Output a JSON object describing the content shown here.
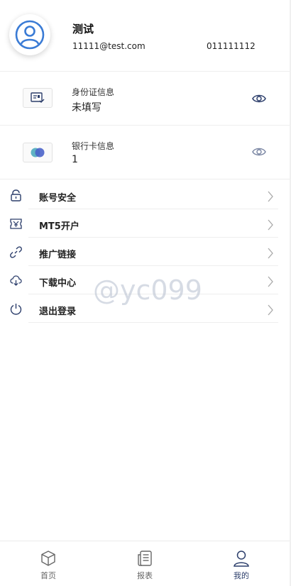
{
  "profile": {
    "username": "测试",
    "email": "11111@test.com",
    "phone": "011111112",
    "avatar_icon": "user-avatar-icon"
  },
  "id_info": {
    "title": "身份证信息",
    "value": "未填写",
    "icon": "id-card-icon"
  },
  "bank_info": {
    "title": "银行卡信息",
    "value": "1",
    "icon": "bank-card-icon"
  },
  "menu": {
    "items": [
      {
        "label": "账号安全",
        "icon": "lock-icon"
      },
      {
        "label": "MT5开户",
        "icon": "ticket-icon"
      },
      {
        "label": "推广链接",
        "icon": "link-icon"
      },
      {
        "label": "下载中心",
        "icon": "cloud-download-icon"
      },
      {
        "label": "退出登录",
        "icon": "power-icon"
      }
    ]
  },
  "watermark": "@yc099",
  "tabbar": {
    "tabs": [
      {
        "label": "首页",
        "icon": "cube-icon"
      },
      {
        "label": "报表",
        "icon": "report-icon"
      },
      {
        "label": "我的",
        "icon": "user-icon"
      }
    ],
    "active": "我的"
  },
  "colors": {
    "accent": "#3a7bd5",
    "icon": "#2c3e6b",
    "divider": "#eeeeee",
    "card_dot_teal": "#5fb3c4",
    "card_dot_blue": "#4a63c9"
  }
}
